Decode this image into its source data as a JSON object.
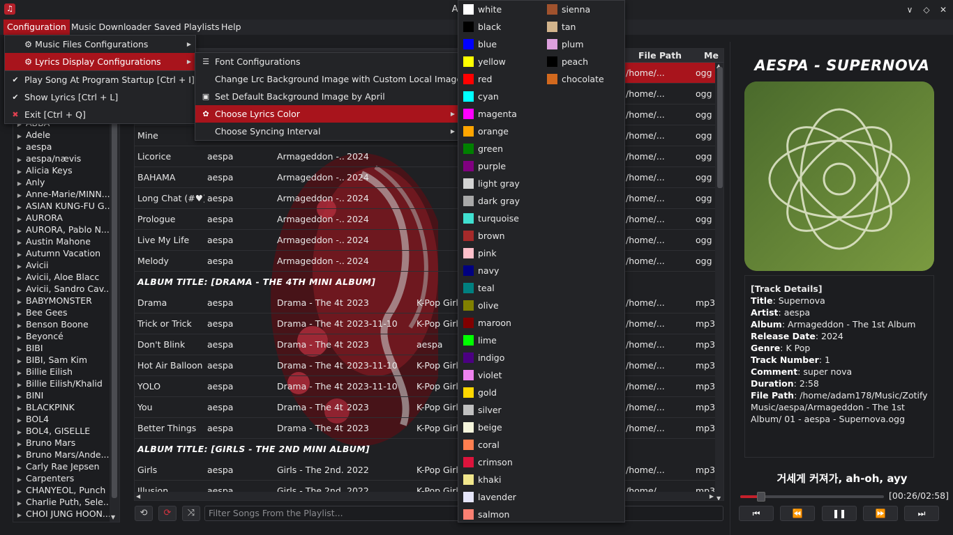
{
  "window": {
    "title": "April Music"
  },
  "menubar": [
    "Configuration",
    "Music Downloader",
    "Saved Playlists",
    "Help"
  ],
  "config_menu": [
    {
      "label": "⚙ Music Files Configurations",
      "icon": "",
      "submenu": true,
      "highlight": false
    },
    {
      "label": "⚙ Lyrics Display Configurations",
      "icon": "",
      "submenu": true,
      "highlight": true
    },
    {
      "label": "Play Song At Program Startup [Ctrl + I]",
      "icon": "✔",
      "submenu": false,
      "highlight": false
    },
    {
      "label": "Show Lyrics [Ctrl + L]",
      "icon": "✔",
      "submenu": false,
      "highlight": false
    },
    {
      "label": "Exit [Ctrl + Q]",
      "icon": "✖",
      "submenu": false,
      "highlight": false
    }
  ],
  "lyrics_menu": [
    {
      "label": "Font Configurations",
      "icon": "font-icon",
      "submenu": false,
      "highlight": false
    },
    {
      "label": "Change Lrc Background Image with Custom Local Image",
      "icon": "",
      "submenu": false,
      "highlight": false
    },
    {
      "label": "Set Default Background Image by April",
      "icon": "image-icon",
      "submenu": false,
      "highlight": false
    },
    {
      "label": "Choose Lyrics Color",
      "icon": "palette-icon",
      "submenu": true,
      "highlight": true
    },
    {
      "label": "Choose Syncing Interval",
      "icon": "",
      "submenu": true,
      "highlight": false
    }
  ],
  "colors_col1": [
    {
      "name": "white",
      "hex": "#ffffff"
    },
    {
      "name": "black",
      "hex": "#000000"
    },
    {
      "name": "blue",
      "hex": "#0000ff"
    },
    {
      "name": "yellow",
      "hex": "#ffff00"
    },
    {
      "name": "red",
      "hex": "#ff0000"
    },
    {
      "name": "cyan",
      "hex": "#00ffff"
    },
    {
      "name": "magenta",
      "hex": "#ff00ff"
    },
    {
      "name": "orange",
      "hex": "#ffa500"
    },
    {
      "name": "green",
      "hex": "#008000"
    },
    {
      "name": "purple",
      "hex": "#800080"
    },
    {
      "name": "light gray",
      "hex": "#d3d3d3"
    },
    {
      "name": "dark gray",
      "hex": "#a9a9a9"
    },
    {
      "name": "turquoise",
      "hex": "#40e0d0"
    },
    {
      "name": "brown",
      "hex": "#a52a2a"
    },
    {
      "name": "pink",
      "hex": "#ffc0cb"
    },
    {
      "name": "navy",
      "hex": "#000080"
    },
    {
      "name": "teal",
      "hex": "#008080"
    },
    {
      "name": "olive",
      "hex": "#808000"
    },
    {
      "name": "maroon",
      "hex": "#800000"
    },
    {
      "name": "lime",
      "hex": "#00ff00"
    },
    {
      "name": "indigo",
      "hex": "#4b0082"
    },
    {
      "name": "violet",
      "hex": "#ee82ee"
    },
    {
      "name": "gold",
      "hex": "#ffd700"
    },
    {
      "name": "silver",
      "hex": "#c0c0c0"
    },
    {
      "name": "beige",
      "hex": "#f5f5dc"
    },
    {
      "name": "coral",
      "hex": "#ff7f50"
    },
    {
      "name": "crimson",
      "hex": "#dc143c"
    },
    {
      "name": "khaki",
      "hex": "#f0e68c"
    },
    {
      "name": "lavender",
      "hex": "#e6e6fa"
    },
    {
      "name": "salmon",
      "hex": "#fa8072"
    }
  ],
  "colors_col2": [
    {
      "name": "sienna",
      "hex": "#a0522d"
    },
    {
      "name": "tan",
      "hex": "#d2b48c"
    },
    {
      "name": "plum",
      "hex": "#dda0dd"
    },
    {
      "name": "peach",
      "hex": "#000000"
    },
    {
      "name": "chocolate",
      "hex": "#d2691e"
    }
  ],
  "artists": [
    "ABBA",
    "Adele",
    "aespa",
    "aespa/nævis",
    "Alicia Keys",
    "Anly",
    "Anne-Marie/MINN...",
    "ASIAN KUNG-FU G...",
    "AURORA",
    "AURORA, Pablo N...",
    "Austin Mahone",
    "Autumn Vacation",
    "Avicii",
    "Avicii, Aloe Blacc",
    "Avicii, Sandro Cav...",
    "BABYMONSTER",
    "Bee Gees",
    "Benson Boone",
    "Beyoncé",
    "BIBI",
    "BIBI, Sam Kim",
    "Billie Eilish",
    "Billie Eilish/Khalid",
    "BINI",
    "BLACKPINK",
    "BOL4",
    "BOL4, GISELLE",
    "Bruno Mars",
    "Bruno Mars/Ande...",
    "Carly Rae Jepsen",
    "Carpenters",
    "CHANYEOL, Punch",
    "Charlie Puth, Sele...",
    "CHOI JUNG HOON..."
  ],
  "table": {
    "headers": {
      "filepath": "File Path",
      "media": "Me"
    },
    "rows": [
      {
        "kind": "song",
        "title": "",
        "artist": "",
        "album": "",
        "year": "",
        "genre": "",
        "path": "/home/...",
        "ext": "ogg",
        "selected": true
      },
      {
        "kind": "song",
        "title": "",
        "artist": "",
        "album": "",
        "year": "",
        "genre": "",
        "path": "/home/...",
        "ext": "ogg"
      },
      {
        "kind": "song",
        "title": "",
        "artist": "",
        "album": "",
        "year": "",
        "genre": "",
        "path": "/home/...",
        "ext": "ogg"
      },
      {
        "kind": "song",
        "title": "Mine",
        "artist": "",
        "album": "",
        "year": "",
        "genre": "",
        "path": "/home/...",
        "ext": "ogg"
      },
      {
        "kind": "song",
        "title": "Licorice",
        "artist": "aespa",
        "album": "Armageddon -...",
        "year": "2024",
        "genre": "",
        "path": "/home/...",
        "ext": "ogg"
      },
      {
        "kind": "song",
        "title": "BAHAMA",
        "artist": "aespa",
        "album": "Armageddon -...",
        "year": "2024",
        "genre": "",
        "path": "/home/...",
        "ext": "ogg"
      },
      {
        "kind": "song",
        "title": "Long Chat (#♥)",
        "artist": "aespa",
        "album": "Armageddon -...",
        "year": "2024",
        "genre": "",
        "path": "/home/...",
        "ext": "ogg"
      },
      {
        "kind": "song",
        "title": "Prologue",
        "artist": "aespa",
        "album": "Armageddon -...",
        "year": "2024",
        "genre": "",
        "path": "/home/...",
        "ext": "ogg"
      },
      {
        "kind": "song",
        "title": "Live My Life",
        "artist": "aespa",
        "album": "Armageddon -...",
        "year": "2024",
        "genre": "",
        "path": "/home/...",
        "ext": "ogg"
      },
      {
        "kind": "song",
        "title": "Melody",
        "artist": "aespa",
        "album": "Armageddon -...",
        "year": "2024",
        "genre": "",
        "path": "/home/...",
        "ext": "ogg"
      },
      {
        "kind": "album",
        "text": "ALBUM TITLE: [DRAMA - THE 4TH MINI ALBUM]"
      },
      {
        "kind": "song",
        "title": "Drama",
        "artist": "aespa",
        "album": "Drama - The 4t...",
        "year": "2023",
        "genre": "K-Pop Girl",
        "path": "/home/...",
        "ext": "mp3"
      },
      {
        "kind": "song",
        "title": "Trick or Trick",
        "artist": "aespa",
        "album": "Drama - The 4t...",
        "year": "2023-11-10",
        "genre": "K-Pop Girl",
        "path": "/home/...",
        "ext": "mp3"
      },
      {
        "kind": "song",
        "title": "Don't Blink",
        "artist": "aespa",
        "album": "Drama - The 4t...",
        "year": "2023",
        "genre": "aespa",
        "path": "/home/...",
        "ext": "mp3"
      },
      {
        "kind": "song",
        "title": "Hot Air Balloon",
        "artist": "aespa",
        "album": "Drama - The 4t...",
        "year": "2023-11-10",
        "genre": "K-Pop Girl",
        "path": "/home/...",
        "ext": "mp3"
      },
      {
        "kind": "song",
        "title": "YOLO",
        "artist": "aespa",
        "album": "Drama - The 4t...",
        "year": "2023-11-10",
        "genre": "K-Pop Girl",
        "path": "/home/...",
        "ext": "mp3"
      },
      {
        "kind": "song",
        "title": "You",
        "artist": "aespa",
        "album": "Drama - The 4t...",
        "year": "2023",
        "genre": "K-Pop Girl",
        "path": "/home/...",
        "ext": "mp3"
      },
      {
        "kind": "song",
        "title": "Better Things",
        "artist": "aespa",
        "album": "Drama - The 4t...",
        "year": "2023",
        "genre": "K-Pop Girl",
        "path": "/home/...",
        "ext": "mp3"
      },
      {
        "kind": "album",
        "text": "ALBUM TITLE: [GIRLS - THE 2ND MINI ALBUM]"
      },
      {
        "kind": "song",
        "title": "Girls",
        "artist": "aespa",
        "album": "Girls - The 2nd...",
        "year": "2022",
        "genre": "K-Pop Girl",
        "path": "/home/...",
        "ext": "mp3"
      },
      {
        "kind": "song",
        "title": "Illusion",
        "artist": "aespa",
        "album": "Girls - The 2nd...",
        "year": "2022",
        "genre": "K-Pop Girl",
        "path": "/home/...",
        "ext": "mp3"
      }
    ]
  },
  "filter_placeholder": "Filter Songs From the Playlist...",
  "now_playing": {
    "heading": "AESPA - SUPERNOVA",
    "details_title": "[Track Details]",
    "details": [
      {
        "k": "Title",
        "v": "Supernova"
      },
      {
        "k": "Artist",
        "v": "aespa"
      },
      {
        "k": "Album",
        "v": "Armageddon - The 1st Album"
      },
      {
        "k": "Release Date",
        "v": "2024"
      },
      {
        "k": "Genre",
        "v": "K Pop"
      },
      {
        "k": "Track Number",
        "v": "1"
      },
      {
        "k": "Comment",
        "v": "super nova"
      },
      {
        "k": "Duration",
        "v": "2:58"
      },
      {
        "k": "File Path",
        "v": "/home/adam178/Music/Zotify Music/aespa/Armageddon - The 1st Album/ 01 - aespa - Supernova.ogg"
      }
    ],
    "lyric": "거세게 커져가, ah-oh, ayy",
    "time": "[00:26/02:58]",
    "progress": 0.146
  },
  "accent": "#a8141c"
}
